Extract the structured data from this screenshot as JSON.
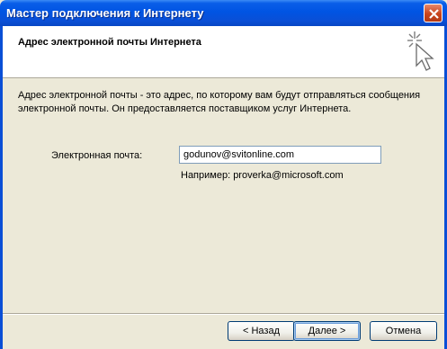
{
  "window": {
    "title": "Мастер подключения к Интернету"
  },
  "header": {
    "title": "Адрес электронной почты Интернета",
    "icon": "wizard-sparkle-cursor-icon"
  },
  "body": {
    "description": "Адрес электронной почты - это адрес, по которому вам будут отправляться сообщения электронной почты. Он предоставляется поставщиком услуг Интернета.",
    "email_label": "Электронная почта:",
    "email_value": "godunov@svitonline.com",
    "example": "Например: proverka@microsoft.com"
  },
  "buttons": {
    "back": "< Назад",
    "next": "Далее >",
    "cancel": "Отмена"
  },
  "colors": {
    "titlebar": "#0054e3",
    "close_button": "#c8441c",
    "dialog_bg": "#ece9d8",
    "header_bg": "#ffffff"
  }
}
